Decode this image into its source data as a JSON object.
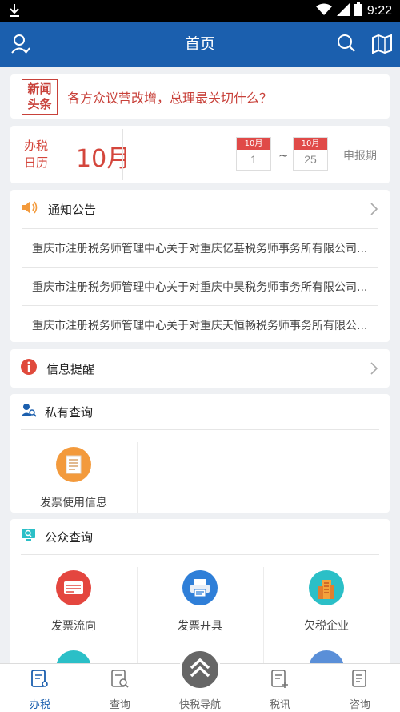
{
  "status_bar": {
    "time": "9:22"
  },
  "app_bar": {
    "title": "首页"
  },
  "news": {
    "tag": "新闻头条",
    "headline": "各方众议营改增，总理最关切什么？"
  },
  "calendar": {
    "label": "办税日历",
    "month": "10月",
    "start": {
      "month": "10月",
      "day": "1"
    },
    "end": {
      "month": "10月",
      "day": "25"
    },
    "separator": "~",
    "period": "申报期"
  },
  "notice": {
    "title": "通知公告",
    "items": [
      "重庆市注册税务师管理中心关于对重庆亿基税务师事务所有限公司...",
      "重庆市注册税务师管理中心关于对重庆中昊税务师事务所有限公司...",
      "重庆市注册税务师管理中心关于对重庆天恒畅税务师事务所有限公..."
    ]
  },
  "reminder": {
    "title": "信息提醒"
  },
  "private_query": {
    "title": "私有查询",
    "items": [
      {
        "label": "发票使用信息",
        "icon": "invoice-usage-icon",
        "color": "#f39a3c"
      }
    ]
  },
  "public_query": {
    "title": "公众查询",
    "items": [
      {
        "label": "发票流向",
        "icon": "invoice-flow-icon",
        "color": "#e4463f"
      },
      {
        "label": "发票开具",
        "icon": "invoice-print-icon",
        "color": "#2f7fd8"
      },
      {
        "label": "欠税企业",
        "icon": "tax-arrears-company-icon",
        "color": "#2bbfc7"
      }
    ]
  },
  "bottom_nav": {
    "items": [
      {
        "label": "办税",
        "icon": "tax-handling-icon",
        "active": true
      },
      {
        "label": "查询",
        "icon": "query-icon",
        "active": false
      },
      {
        "label": "快税导航",
        "icon": "quick-nav-icon",
        "active": false
      },
      {
        "label": "税讯",
        "icon": "tax-news-icon",
        "active": false
      },
      {
        "label": "咨询",
        "icon": "consult-icon",
        "active": false
      }
    ]
  },
  "colors": {
    "primary": "#1b5fae",
    "accent_red": "#d4463c"
  }
}
